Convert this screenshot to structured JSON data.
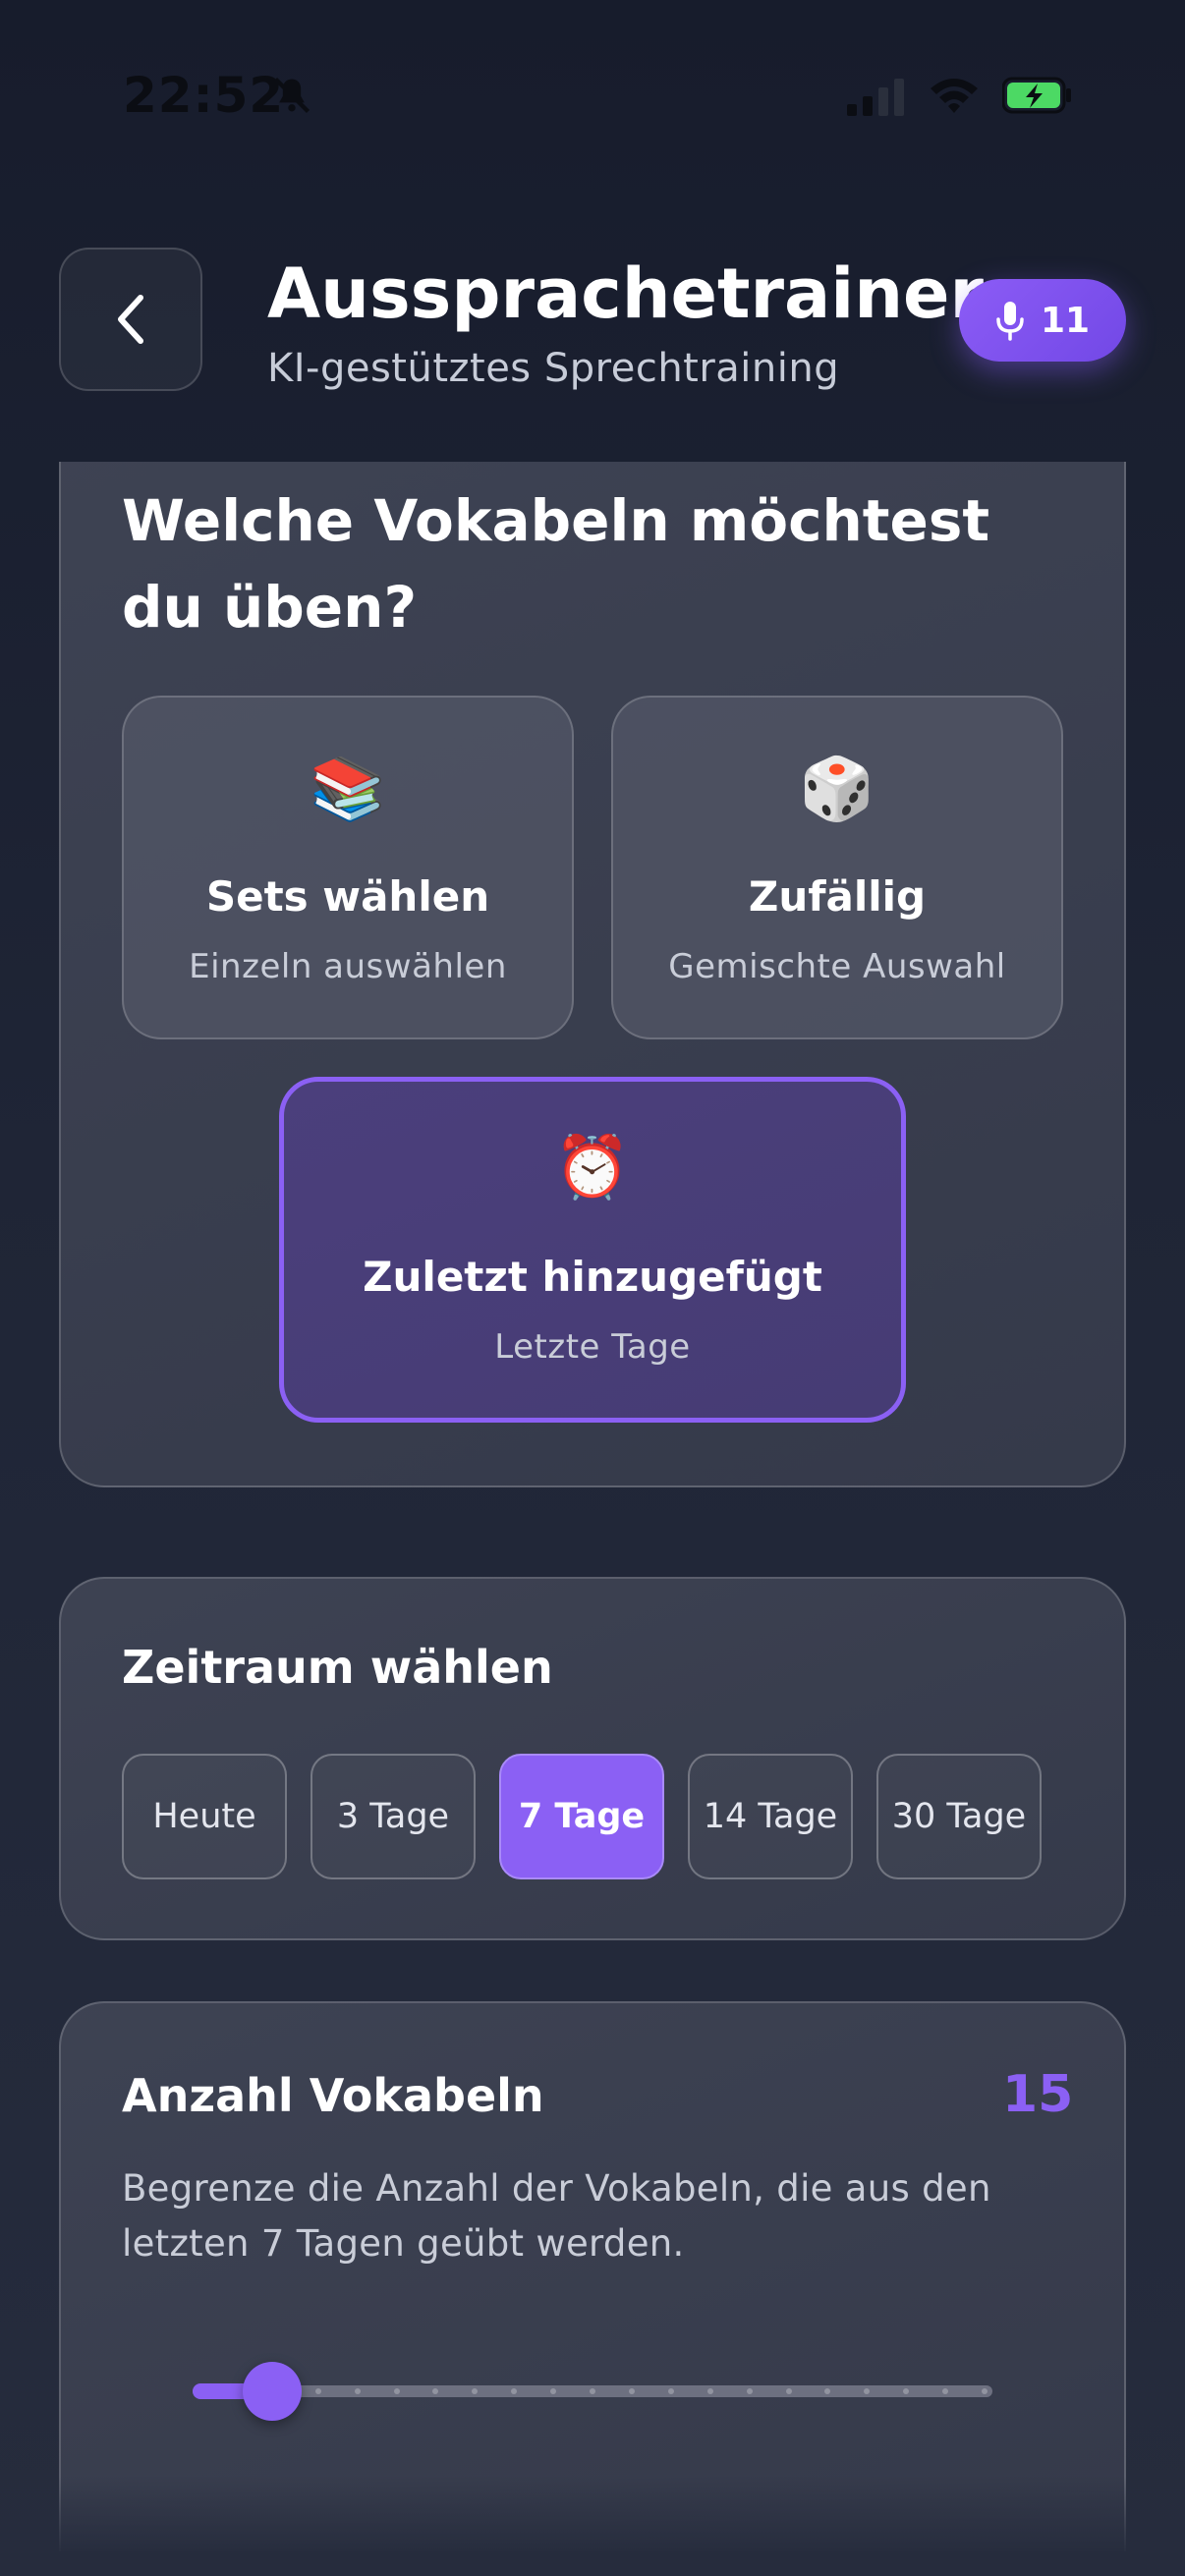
{
  "status_bar": {
    "time": "22:52"
  },
  "header": {
    "title": "Aussprachetrainer",
    "subtitle": "KI-gestütztes Sprechtraining",
    "mic_count": "11"
  },
  "selection": {
    "question": "Welche Vokabeln möchtest du üben?",
    "options": [
      {
        "icon": "📚",
        "title": "Sets wählen",
        "subtitle": "Einzeln auswählen",
        "selected": false
      },
      {
        "icon": "🎲",
        "title": "Zufällig",
        "subtitle": "Gemischte Auswahl",
        "selected": false
      },
      {
        "icon": "⏰",
        "title": "Zuletzt hinzugefügt",
        "subtitle": "Letzte Tage",
        "selected": true
      }
    ]
  },
  "time_range": {
    "title": "Zeitraum wählen",
    "chips": [
      {
        "label": "Heute",
        "active": false
      },
      {
        "label": "3 Tage",
        "active": false
      },
      {
        "label": "7 Tage",
        "active": true
      },
      {
        "label": "14 Tage",
        "active": false
      },
      {
        "label": "30 Tage",
        "active": false
      }
    ]
  },
  "vocab_count": {
    "title": "Anzahl Vokabeln",
    "value": "15",
    "description": "Begrenze die Anzahl der Vokabeln, die aus den letzten 7 Tagen geübt werden.",
    "slider_fraction": 0.1
  },
  "colors": {
    "accent": "#8b60f4",
    "background": "#1f2536",
    "card": "#3d4253"
  }
}
